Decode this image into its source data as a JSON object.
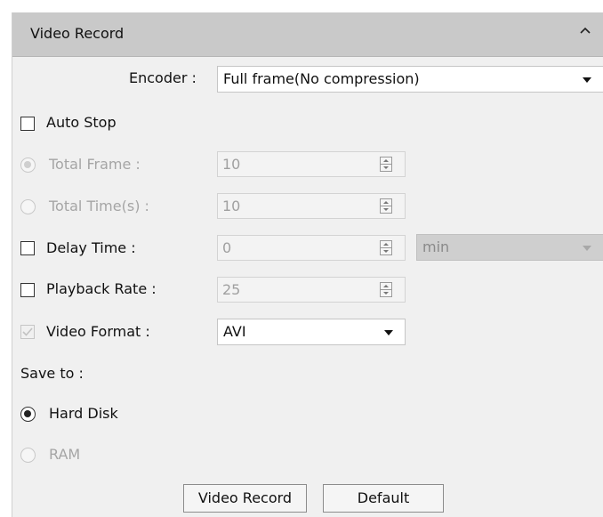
{
  "panel": {
    "title": "Video Record",
    "collapse_icon": "chevron-up-icon"
  },
  "encoder": {
    "label": "Encoder :",
    "value": "Full frame(No compression)"
  },
  "auto_stop": {
    "label": "Auto Stop",
    "checked": false
  },
  "total_frame": {
    "label": "Total Frame  :",
    "value": "10",
    "selected": true,
    "enabled": false
  },
  "total_time": {
    "label": "Total Time(s) :",
    "value": "10",
    "selected": false,
    "enabled": false
  },
  "delay_time": {
    "label": "Delay Time :",
    "value": "0",
    "unit": "min",
    "checked": false
  },
  "playback_rate": {
    "label": "Playback Rate :",
    "value": "25",
    "checked": false
  },
  "video_format": {
    "label": "Video Format :",
    "value": "AVI",
    "checked": true,
    "enabled": false
  },
  "save_to": {
    "label": "Save to :",
    "hard_disk": "Hard Disk",
    "ram": "RAM",
    "selected": "Hard Disk"
  },
  "buttons": {
    "record": "Video Record",
    "default": "Default"
  }
}
